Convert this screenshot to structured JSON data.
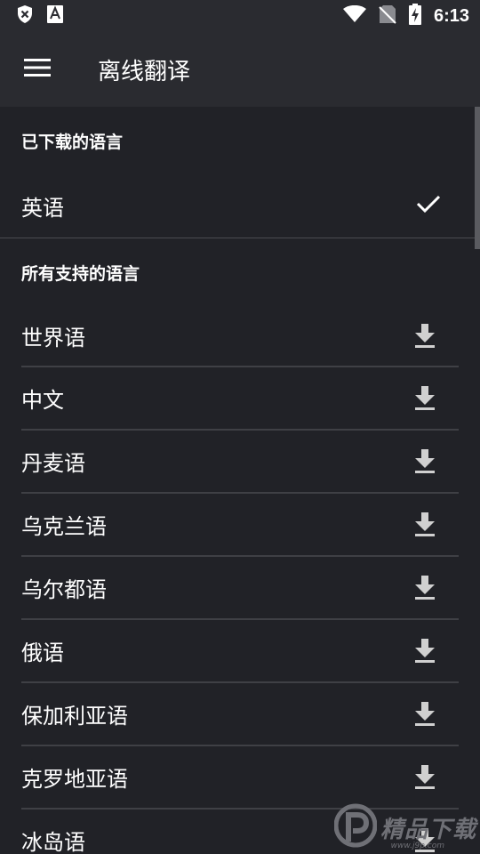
{
  "status_bar": {
    "time": "6:13",
    "icons_left": [
      "shield-x-icon",
      "text-a-icon"
    ],
    "icons_right": [
      "wifi-icon",
      "no-sim-icon",
      "battery-charging-icon"
    ]
  },
  "app_bar": {
    "title": "离线翻译",
    "menu_icon": "hamburger-menu-icon"
  },
  "downloaded": {
    "header": "已下载的语言",
    "items": [
      {
        "label": "英语",
        "status_icon": "check-icon"
      }
    ]
  },
  "all_supported": {
    "header": "所有支持的语言",
    "items": [
      {
        "label": "世界语",
        "action_icon": "download-icon"
      },
      {
        "label": "中文",
        "action_icon": "download-icon"
      },
      {
        "label": "丹麦语",
        "action_icon": "download-icon"
      },
      {
        "label": "乌克兰语",
        "action_icon": "download-icon"
      },
      {
        "label": "乌尔都语",
        "action_icon": "download-icon"
      },
      {
        "label": "俄语",
        "action_icon": "download-icon"
      },
      {
        "label": "保加利亚语",
        "action_icon": "download-icon"
      },
      {
        "label": "克罗地亚语",
        "action_icon": "download-icon"
      },
      {
        "label": "冰岛语",
        "action_icon": "download-icon"
      }
    ]
  },
  "watermark": {
    "text": "精品下载",
    "subtext": "www.j9p.com"
  },
  "colors": {
    "background": "#212227",
    "app_bar": "#2a2b30",
    "divider": "#3f4045",
    "icon": "#d0d0d0"
  }
}
